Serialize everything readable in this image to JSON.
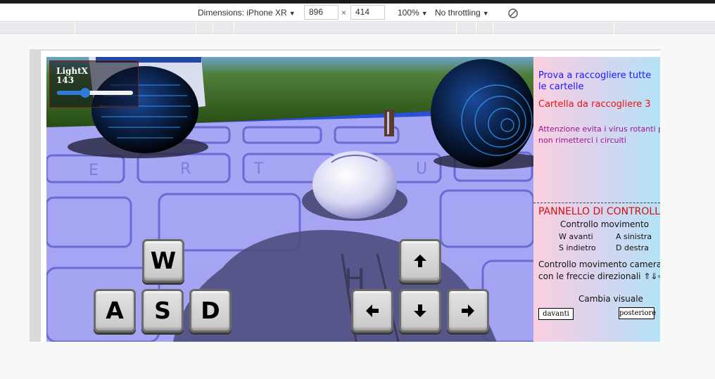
{
  "devtools": {
    "dimensions_label": "Dimensions: iPhone XR",
    "width_value": "896",
    "times": "×",
    "height_value": "414",
    "zoom_label": "100%",
    "throttling_label": "No throttling",
    "dropdown_caret": "▼",
    "rotate_icon": "rotate-icon"
  },
  "scene": {
    "light_control": {
      "label": "LightX",
      "value": "143",
      "level_fraction": 0.37
    },
    "wasd_keys": {
      "w": "W",
      "a": "A",
      "s": "S",
      "d": "D"
    },
    "arrow_keys": {
      "up": "arrow-up-icon",
      "left": "arrow-left-icon",
      "down": "arrow-down-icon",
      "right": "arrow-right-icon"
    }
  },
  "info_panel": {
    "intro_line1": "Prova a raccogliere tutte",
    "intro_line2": "le cartelle",
    "folder_status": "Cartella da raccogliere 3",
    "warning_line1": "Attenzione evita i virus rotanti per",
    "warning_line2": "non rimetterci i circuiti",
    "control_title": "PANNELLO DI CONTROLLO",
    "movement_title": "Controllo movimento",
    "w_forward": "W avanti",
    "a_left": "A sinistra",
    "s_back": "S indietro",
    "d_right": "D destra",
    "camera_line1": "Controllo movimento camera",
    "camera_line2": "con le freccie direzionali ⇑⇓⇒⇐",
    "change_view": "Cambia visuale",
    "front_button": "davanti",
    "rear_button": "posteriore"
  },
  "colors": {
    "panel_text_blue": "#1a1aff",
    "panel_text_red": "#ee1111",
    "panel_text_purple": "#a0118f",
    "control_title_red": "#d41010",
    "slider_accent": "#2c7bd6"
  }
}
